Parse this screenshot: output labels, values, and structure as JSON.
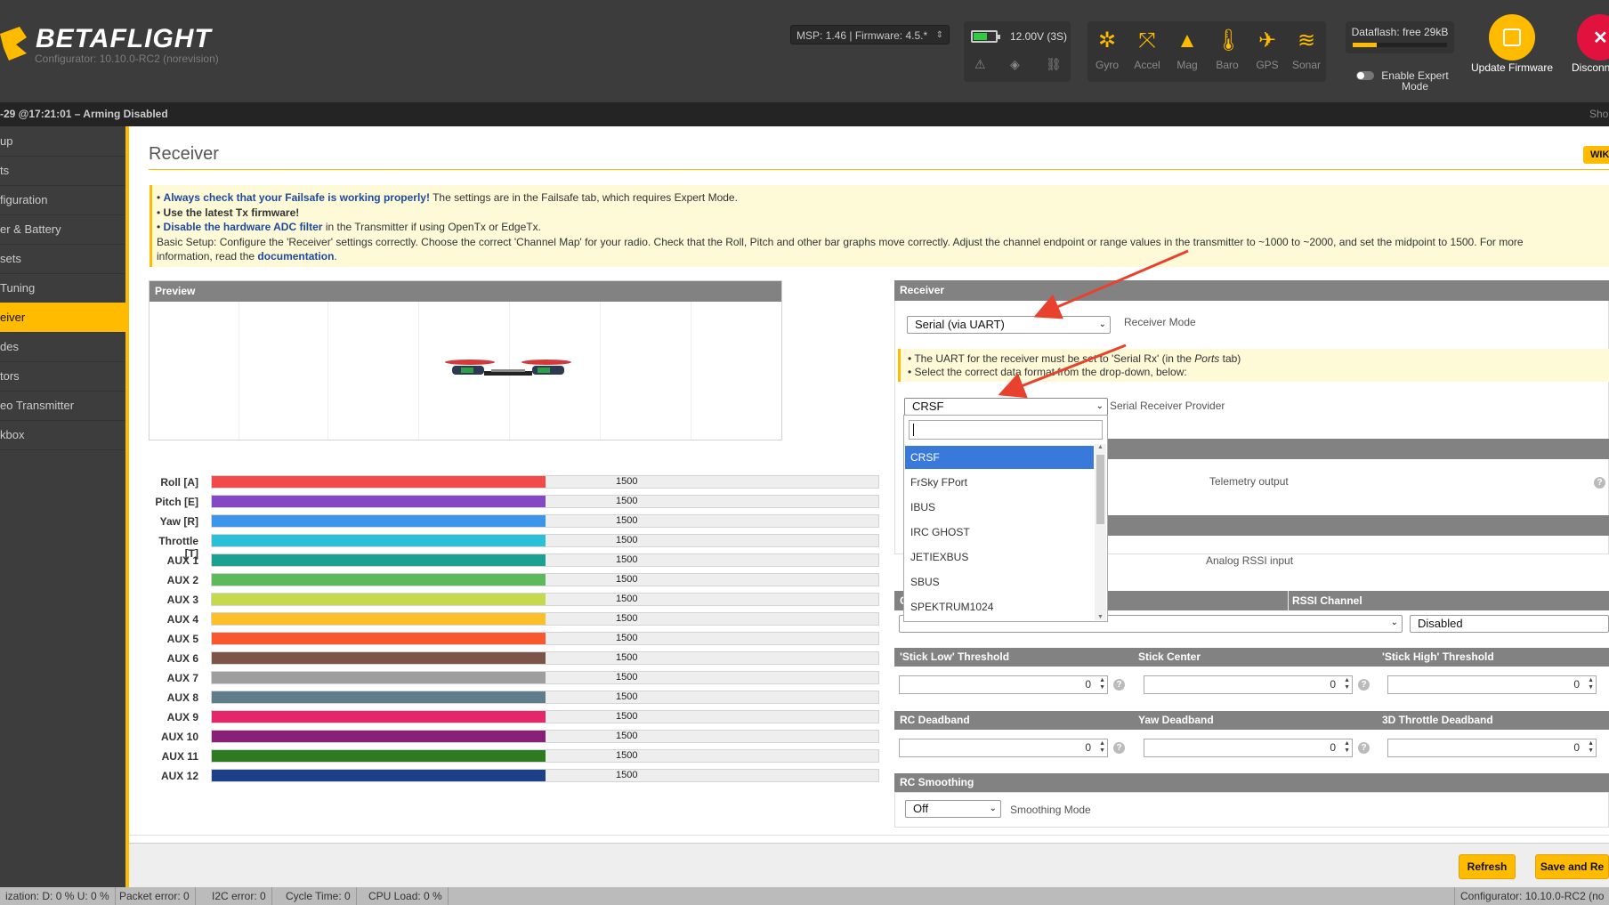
{
  "header": {
    "logo": "BETAFLIGHT",
    "version": "Configurator: 10.10.0-RC2 (norevision)",
    "msp_select": "MSP: 1.46 | Firmware: 4.5.*",
    "battery": "12.00V (3S)",
    "sensors": [
      {
        "label": "Gyro",
        "icon": "gyro-icon"
      },
      {
        "label": "Accel",
        "icon": "accel-icon"
      },
      {
        "label": "Mag",
        "icon": "mag-icon"
      },
      {
        "label": "Baro",
        "icon": "baro-icon"
      },
      {
        "label": "GPS",
        "icon": "gps-icon"
      },
      {
        "label": "Sonar",
        "icon": "sonar-icon"
      }
    ],
    "dataflash": "Dataflash: free 29kB",
    "dataflash_used_fraction": 0.25,
    "expert_mode": "Enable Expert Mode",
    "update_firmware": "Update Firmware",
    "disconnect": "Disconn"
  },
  "status_strip": "-29 @17:21:01 – Arming Disabled",
  "status_strip_right": "Sho",
  "sidebar": {
    "items": [
      {
        "label": "up"
      },
      {
        "label": "ts"
      },
      {
        "label": "figuration"
      },
      {
        "label": "er & Battery"
      },
      {
        "label": "sets"
      },
      {
        "label": " Tuning"
      },
      {
        "label": "eiver",
        "active": true
      },
      {
        "label": "des"
      },
      {
        "label": "tors"
      },
      {
        "label": "eo Transmitter"
      },
      {
        "label": "kbox"
      }
    ]
  },
  "page": {
    "title": "Receiver",
    "wiki": "WIK",
    "note": {
      "line1_bold": "Always check that your Failsafe is working properly!",
      "line1_rest": " The settings are in the Failsafe tab, which requires Expert Mode.",
      "line2": "Use the latest Tx firmware!",
      "line3_bold": "Disable the hardware ADC filter",
      "line3_rest": " in the Transmitter if using OpenTx or EdgeTx.",
      "line4": "Basic Setup: Configure the 'Receiver' settings correctly. Choose the correct 'Channel Map' for your radio. Check that the Roll, Pitch and other bar graphs move correctly. Adjust the channel endpoint or range values in the transmitter to ~1000 to ~2000, and set the midpoint to 1500. For more",
      "line5_pre": "information, read the ",
      "line5_link": "documentation",
      "line5_post": "."
    }
  },
  "preview": {
    "title": "Preview"
  },
  "channels": [
    {
      "label": "Roll [A]",
      "value": "1500",
      "color": "#f14a48"
    },
    {
      "label": "Pitch [E]",
      "value": "1500",
      "color": "#8447c6"
    },
    {
      "label": "Yaw [R]",
      "value": "1500",
      "color": "#3b95e9"
    },
    {
      "label": "Throttle [T]",
      "value": "1500",
      "color": "#2bbfd8"
    },
    {
      "label": "AUX 1",
      "value": "1500",
      "color": "#1aa191"
    },
    {
      "label": "AUX 2",
      "value": "1500",
      "color": "#5cba5b"
    },
    {
      "label": "AUX 3",
      "value": "1500",
      "color": "#c6d94c"
    },
    {
      "label": "AUX 4",
      "value": "1500",
      "color": "#fbbf2a"
    },
    {
      "label": "AUX 5",
      "value": "1500",
      "color": "#f9582e"
    },
    {
      "label": "AUX 6",
      "value": "1500",
      "color": "#7a5548"
    },
    {
      "label": "AUX 7",
      "value": "1500",
      "color": "#9e9e9e"
    },
    {
      "label": "AUX 8",
      "value": "1500",
      "color": "#5f7d8b"
    },
    {
      "label": "AUX 9",
      "value": "1500",
      "color": "#e4266b"
    },
    {
      "label": "AUX 10",
      "value": "1500",
      "color": "#8a1f78"
    },
    {
      "label": "AUX 11",
      "value": "1500",
      "color": "#2e7b1f"
    },
    {
      "label": "AUX 12",
      "value": "1500",
      "color": "#1d4189"
    }
  ],
  "channel_fill_fraction": 0.5,
  "receiver": {
    "title": "Receiver",
    "mode_select": "Serial (via UART)",
    "mode_label": "Receiver Mode",
    "note1_pre": "The UART for the receiver must be set to 'Serial Rx' (in the ",
    "note1_em": "Ports",
    "note1_post": " tab)",
    "note2": "Select the correct data format from the drop-down, below:",
    "provider_select": "CRSF",
    "provider_label": "Serial Receiver Provider",
    "dropdown_search": "",
    "dropdown_options": [
      "CRSF",
      "FrSky FPort",
      "IBUS",
      "IRC GHOST",
      "JETIEXBUS",
      "SBUS",
      "SPEKTRUM1024"
    ],
    "telemetry_label": "Telemetry output",
    "rssi_input_label": "Analog RSSI input"
  },
  "channel_map": {
    "title": "C",
    "rssi_title": "RSSI Channel",
    "rssi_value": "Disabled"
  },
  "thresholds": {
    "low_title": "'Stick Low' Threshold",
    "low_value": "0",
    "center_title": "Stick Center",
    "center_value": "0",
    "high_title": "'Stick High' Threshold",
    "high_value": "0"
  },
  "deadbands": {
    "rc_title": "RC Deadband",
    "rc_value": "0",
    "yaw_title": "Yaw Deadband",
    "yaw_value": "0",
    "throttle_title": "3D Throttle Deadband",
    "throttle_value": "0"
  },
  "smoothing": {
    "title": "RC Smoothing",
    "select": "Off",
    "label": "Smoothing Mode"
  },
  "buttons": {
    "refresh": "Refresh",
    "save": "Save and Re"
  },
  "footer": {
    "seg1": "ization: D: 0 % U: 0 %",
    "seg2": "Packet error: 0",
    "seg3": "I2C error: 0",
    "seg4": "Cycle Time: 0",
    "seg5": "CPU Load: 0 %",
    "right": "Configurator: 10.10.0-RC2 (no"
  },
  "colors": {
    "accent": "#ffbb00",
    "selected": "#3879d9",
    "arrow": "#e8412e"
  }
}
